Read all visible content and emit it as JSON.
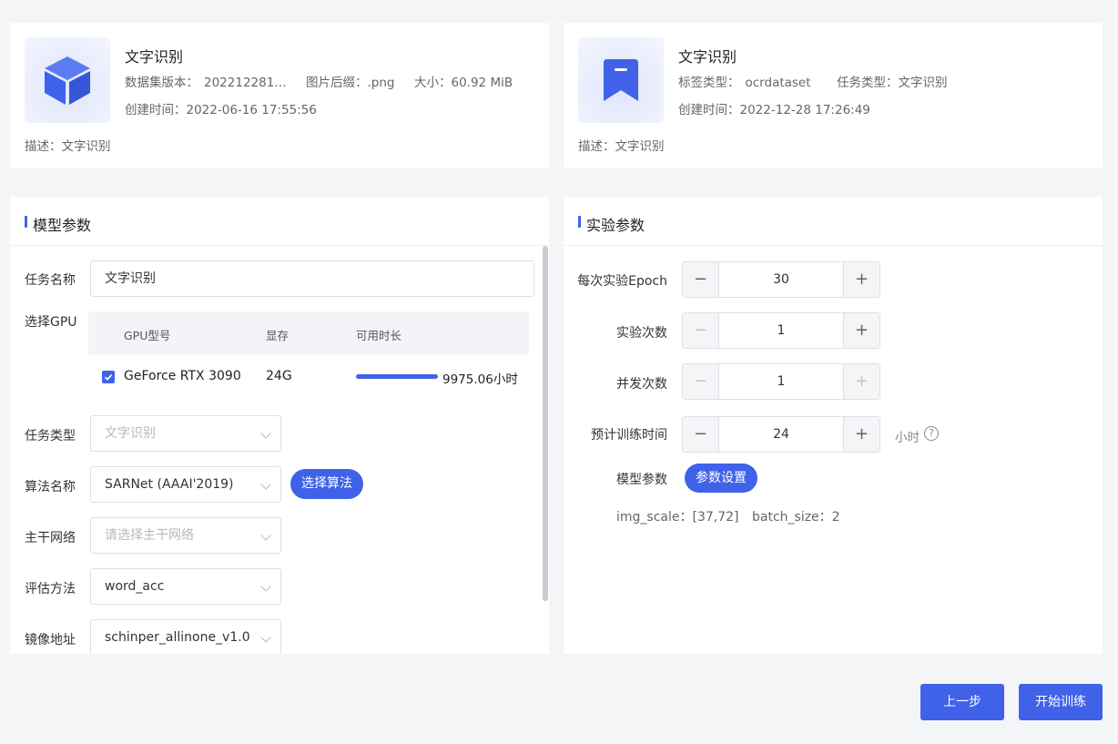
{
  "dataset_card": {
    "title": "文字识别",
    "version_label": "数据集版本：",
    "version_value": "202212281…",
    "suffix_label": "图片后缀：",
    "suffix_value": ".png",
    "size_label": "大小：",
    "size_value": "60.92 MiB",
    "created_label": "创建时间：",
    "created_value": "2022-06-16 17:55:56",
    "desc_label": "描述：",
    "desc_value": "文字识别",
    "icon": "cube-icon"
  },
  "label_card": {
    "title": "文字识别",
    "label_type_label": "标签类型：",
    "label_type_value": "ocrdataset",
    "task_type_label": "任务类型：",
    "task_type_value": "文字识别",
    "created_label": "创建时间：",
    "created_value": "2022-12-28 17:26:49",
    "desc_label": "描述：",
    "desc_value": "文字识别",
    "icon": "bookmark-icon"
  },
  "model_params": {
    "title": "模型参数",
    "task_name": {
      "label": "任务名称",
      "value": "文字识别"
    },
    "gpu": {
      "label": "选择GPU",
      "headers": [
        "GPU型号",
        "显存",
        "可用时长"
      ],
      "rows": [
        {
          "model": "GeForce RTX 3090",
          "memory": "24G",
          "duration": "9975.06小时",
          "checked": true,
          "availability_fraction": 1.0
        }
      ]
    },
    "task_type": {
      "label": "任务类型",
      "value": "文字识别"
    },
    "algorithm": {
      "label": "算法名称",
      "value": "SARNet (AAAI'2019)",
      "button": "选择算法"
    },
    "backbone": {
      "label": "主干网络",
      "placeholder": "请选择主干网络"
    },
    "eval_method": {
      "label": "评估方法",
      "value": "word_acc"
    },
    "image": {
      "label": "镜像地址",
      "value": "schinper_allinone_v1.0"
    }
  },
  "experiment_params": {
    "title": "实验参数",
    "epoch": {
      "label": "每次实验Epoch",
      "value": "30"
    },
    "runs": {
      "label": "实验次数",
      "value": "1"
    },
    "concurrency": {
      "label": "并发次数",
      "value": "1"
    },
    "est_time": {
      "label": "预计训练时间",
      "value": "24",
      "unit": "小时"
    },
    "model_params_label": "模型参数",
    "settings_button": "参数设置",
    "img_scale_label": "img_scale：",
    "img_scale_value": "[37,72]",
    "batch_size_label": "batch_size：",
    "batch_size_value": "2"
  },
  "footer": {
    "prev": "上一步",
    "start": "开始训练"
  },
  "colors": {
    "accent": "#3f62e8",
    "background": "#f4f5f7"
  }
}
